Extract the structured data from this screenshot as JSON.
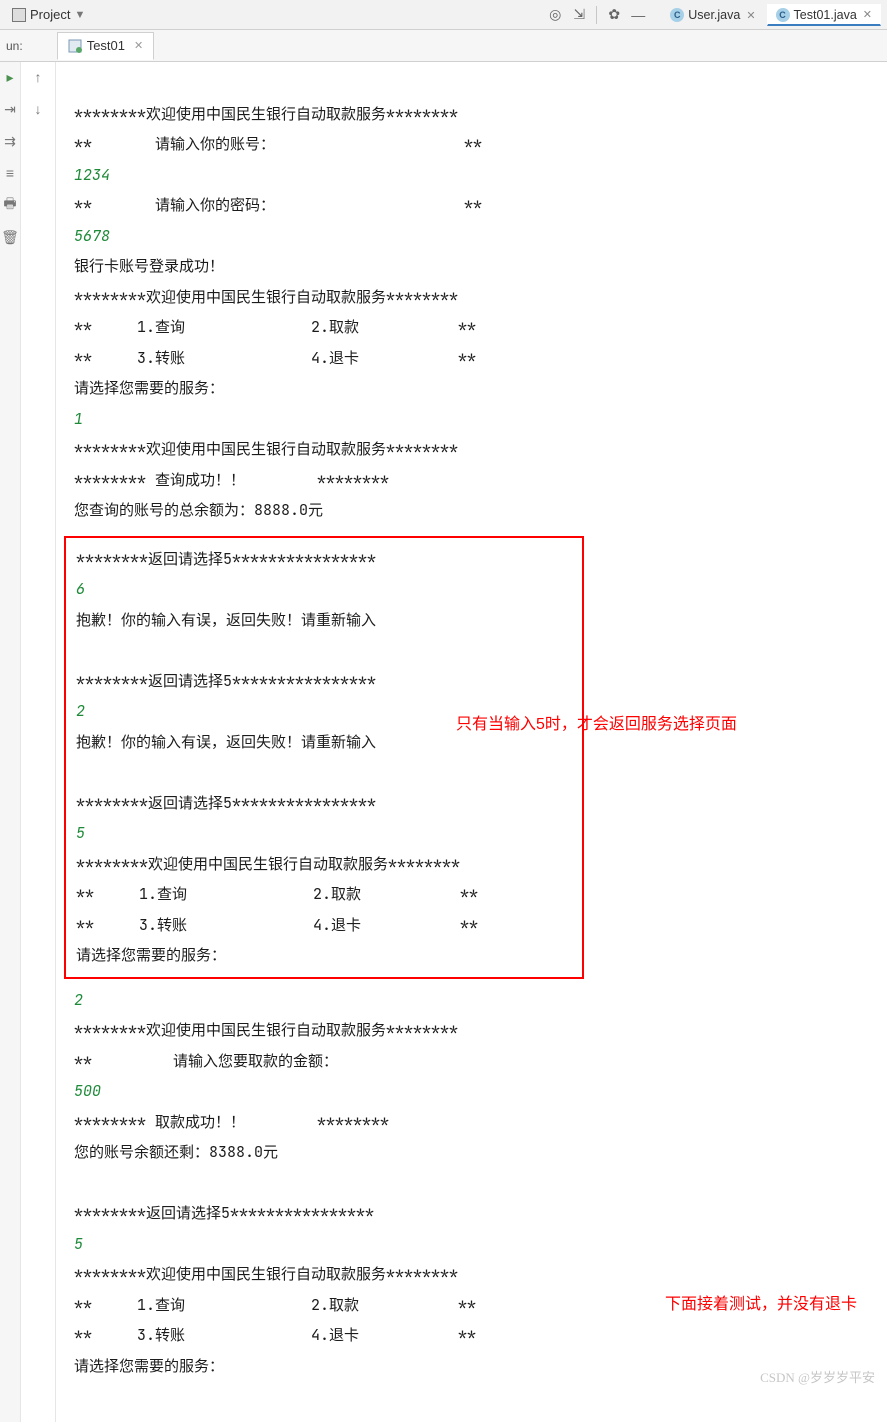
{
  "toolbar": {
    "project_label": "Project"
  },
  "tabs": {
    "user": "User.java",
    "test": "Test01.java"
  },
  "run": {
    "label": "un:",
    "tab": "Test01"
  },
  "console": {
    "l1": "********欢迎使用中国民生银行自动取款服务********",
    "l2": "**       请输入你的账号：                     **",
    "i1": "1234",
    "l3": "**       请输入你的密码：                     **",
    "i2": "5678",
    "l4": "银行卡账号登录成功！",
    "l5": "********欢迎使用中国民生银行自动取款服务********",
    "l6": "**     1.查询              2.取款           **",
    "l7": "**     3.转账              4.退卡           **",
    "l8": "请选择您需要的服务：",
    "i3": "1",
    "l9": "********欢迎使用中国民生银行自动取款服务********",
    "l10": "******** 查询成功！！        ********",
    "l11": "您查询的账号的总余额为：8888.0元",
    "box_l1": "********返回请选择5****************",
    "box_i1": "6",
    "box_l2": "抱歉！你的输入有误，返回失败！请重新输入",
    "box_l3": "********返回请选择5****************",
    "box_i2": "2",
    "box_l4": "抱歉！你的输入有误，返回失败！请重新输入",
    "box_l5": "********返回请选择5****************",
    "box_i3": "5",
    "box_l6": "********欢迎使用中国民生银行自动取款服务********",
    "box_l7": "**     1.查询              2.取款           **",
    "box_l8": "**     3.转账              4.退卡           **",
    "box_l9": "请选择您需要的服务：",
    "i4": "2",
    "l12": "********欢迎使用中国民生银行自动取款服务********",
    "l13": "**         请输入您要取款的金额：",
    "i5": "500",
    "l14": "******** 取款成功！！        ********",
    "l15": "您的账号余额还剩：8388.0元",
    "l16": "********返回请选择5****************",
    "i6": "5",
    "l17": "********欢迎使用中国民生银行自动取款服务********",
    "l18": "**     1.查询              2.取款           **",
    "l19": "**     3.转账              4.退卡           **",
    "l20": "请选择您需要的服务："
  },
  "anno": {
    "a1": "只有当输入5时，才会返回服务选择页面",
    "a2": "下面接着测试，并没有退卡"
  },
  "watermark": "CSDN @岁岁岁平安"
}
